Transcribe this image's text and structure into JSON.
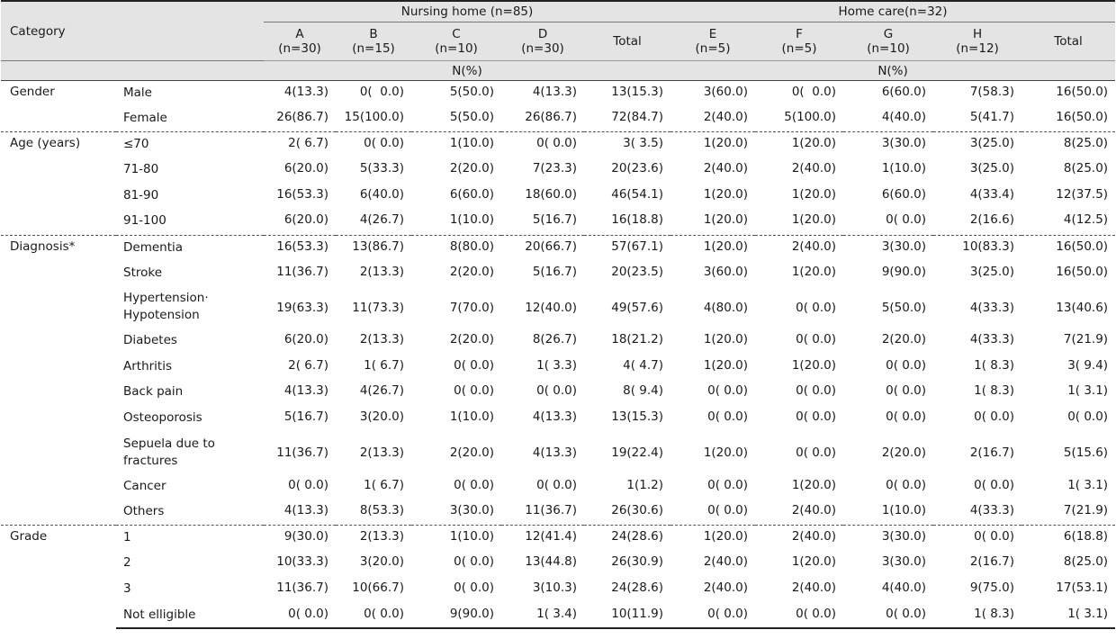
{
  "header": {
    "category": "Category",
    "group_nursing": "Nursing home (n=85)",
    "group_home": "Home care(n=32)",
    "columns": [
      {
        "name": "A",
        "n": "(n=30)"
      },
      {
        "name": "B",
        "n": "(n=15)"
      },
      {
        "name": "C",
        "n": "(n=10)"
      },
      {
        "name": "D",
        "n": "(n=30)"
      },
      {
        "name": "Total",
        "n": ""
      },
      {
        "name": "E",
        "n": "(n=5)"
      },
      {
        "name": "F",
        "n": "(n=5)"
      },
      {
        "name": "G",
        "n": "(n=10)"
      },
      {
        "name": "H",
        "n": "(n=12)"
      },
      {
        "name": "Total",
        "n": ""
      }
    ],
    "unit_nursing": "N(%)",
    "unit_home": "N(%)"
  },
  "categories": [
    {
      "label": "Gender",
      "rows": [
        {
          "label": "Male",
          "values": [
            "4(13.3)",
            "0(  0.0)",
            "5(50.0)",
            "4(13.3)",
            "13(15.3)",
            "3(60.0)",
            "0(  0.0)",
            "6(60.0)",
            "7(58.3)",
            "16(50.0)"
          ]
        },
        {
          "label": "Female",
          "values": [
            "26(86.7)",
            "15(100.0)",
            "5(50.0)",
            "26(86.7)",
            "72(84.7)",
            "2(40.0)",
            "5(100.0)",
            "4(40.0)",
            "5(41.7)",
            "16(50.0)"
          ]
        }
      ]
    },
    {
      "label": "Age (years)",
      "rows": [
        {
          "label": "≤70",
          "values": [
            "2( 6.7)",
            "0( 0.0)",
            "1(10.0)",
            "0( 0.0)",
            "3( 3.5)",
            "1(20.0)",
            "1(20.0)",
            "3(30.0)",
            "3(25.0)",
            "8(25.0)"
          ]
        },
        {
          "label": "71-80",
          "values": [
            "6(20.0)",
            "5(33.3)",
            "2(20.0)",
            "7(23.3)",
            "20(23.6)",
            "2(40.0)",
            "2(40.0)",
            "1(10.0)",
            "3(25.0)",
            "8(25.0)"
          ]
        },
        {
          "label": "81-90",
          "values": [
            "16(53.3)",
            "6(40.0)",
            "6(60.0)",
            "18(60.0)",
            "46(54.1)",
            "1(20.0)",
            "1(20.0)",
            "6(60.0)",
            "4(33.4)",
            "12(37.5)"
          ]
        },
        {
          "label": "91-100",
          "values": [
            "6(20.0)",
            "4(26.7)",
            "1(10.0)",
            "5(16.7)",
            "16(18.8)",
            "1(20.0)",
            "1(20.0)",
            "0( 0.0)",
            "2(16.6)",
            "4(12.5)"
          ]
        }
      ]
    },
    {
      "label": "Diagnosis*",
      "rows": [
        {
          "label": "Dementia",
          "values": [
            "16(53.3)",
            "13(86.7)",
            "8(80.0)",
            "20(66.7)",
            "57(67.1)",
            "1(20.0)",
            "2(40.0)",
            "3(30.0)",
            "10(83.3)",
            "16(50.0)"
          ]
        },
        {
          "label": "Stroke",
          "values": [
            "11(36.7)",
            "2(13.3)",
            "2(20.0)",
            "5(16.7)",
            "20(23.5)",
            "3(60.0)",
            "1(20.0)",
            "9(90.0)",
            "3(25.0)",
            "16(50.0)"
          ]
        },
        {
          "label": "Hypertension·",
          "label2": "Hypotension",
          "values": [
            "19(63.3)",
            "11(73.3)",
            "7(70.0)",
            "12(40.0)",
            "49(57.6)",
            "4(80.0)",
            "0( 0.0)",
            "5(50.0)",
            "4(33.3)",
            "13(40.6)"
          ]
        },
        {
          "label": "Diabetes",
          "values": [
            "6(20.0)",
            "2(13.3)",
            "2(20.0)",
            "8(26.7)",
            "18(21.2)",
            "1(20.0)",
            "0( 0.0)",
            "2(20.0)",
            "4(33.3)",
            "7(21.9)"
          ]
        },
        {
          "label": "Arthritis",
          "values": [
            "2( 6.7)",
            "1( 6.7)",
            "0( 0.0)",
            "1( 3.3)",
            "4( 4.7)",
            "1(20.0)",
            "1(20.0)",
            "0( 0.0)",
            "1( 8.3)",
            "3( 9.4)"
          ]
        },
        {
          "label": "Back pain",
          "values": [
            "4(13.3)",
            "4(26.7)",
            "0( 0.0)",
            "0( 0.0)",
            "8( 9.4)",
            "0( 0.0)",
            "0( 0.0)",
            "0( 0.0)",
            "1( 8.3)",
            "1( 3.1)"
          ]
        },
        {
          "label": "Osteoporosis",
          "values": [
            "5(16.7)",
            "3(20.0)",
            "1(10.0)",
            "4(13.3)",
            "13(15.3)",
            "0( 0.0)",
            "0( 0.0)",
            "0( 0.0)",
            "0( 0.0)",
            "0( 0.0)"
          ]
        },
        {
          "label": "Sepuela due to",
          "label2": "fractures",
          "values": [
            "11(36.7)",
            "2(13.3)",
            "2(20.0)",
            "4(13.3)",
            "19(22.4)",
            "1(20.0)",
            "0( 0.0)",
            "2(20.0)",
            "2(16.7)",
            "5(15.6)"
          ]
        },
        {
          "label": "Cancer",
          "values": [
            "0( 0.0)",
            "1( 6.7)",
            "0( 0.0)",
            "0( 0.0)",
            "1(1.2)",
            "0( 0.0)",
            "1(20.0)",
            "0( 0.0)",
            "0( 0.0)",
            "1( 3.1)"
          ]
        },
        {
          "label": "Others",
          "values": [
            "4(13.3)",
            "8(53.3)",
            "3(30.0)",
            "11(36.7)",
            "26(30.6)",
            "0( 0.0)",
            "2(40.0)",
            "1(10.0)",
            "4(33.3)",
            "7(21.9)"
          ]
        }
      ]
    },
    {
      "label": "Grade",
      "rows": [
        {
          "label": "1",
          "values": [
            "9(30.0)",
            "2(13.3)",
            "1(10.0)",
            "12(41.4)",
            "24(28.6)",
            "1(20.0)",
            "2(40.0)",
            "3(30.0)",
            "0( 0.0)",
            "6(18.8)"
          ]
        },
        {
          "label": "2",
          "values": [
            "10(33.3)",
            "3(20.0)",
            "0( 0.0)",
            "13(44.8)",
            "26(30.9)",
            "2(40.0)",
            "1(20.0)",
            "3(30.0)",
            "2(16.7)",
            "8(25.0)"
          ]
        },
        {
          "label": "3",
          "values": [
            "11(36.7)",
            "10(66.7)",
            "0( 0.0)",
            "3(10.3)",
            "24(28.6)",
            "2(40.0)",
            "2(40.0)",
            "4(40.0)",
            "9(75.0)",
            "17(53.1)"
          ]
        },
        {
          "label": "Not elligible",
          "values": [
            "0( 0.0)",
            "0( 0.0)",
            "9(90.0)",
            "1( 3.4)",
            "10(11.9)",
            "0( 0.0)",
            "0( 0.0)",
            "0( 0.0)",
            "1( 8.3)",
            "1( 3.1)"
          ]
        }
      ]
    }
  ]
}
